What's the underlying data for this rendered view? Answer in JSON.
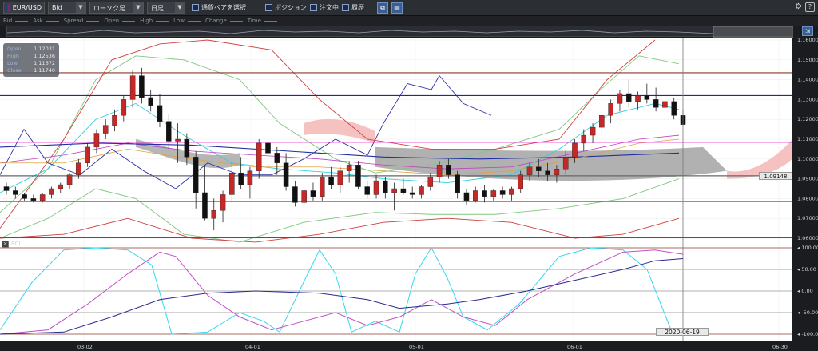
{
  "toolbar": {
    "symbol": "EUR/USD",
    "price_type": "Bid",
    "chart_type": "ローソク足",
    "timeframe": "日足",
    "select_pair_label": "通貨ペアを選択",
    "position_label": "ポジション",
    "orders_label": "注文中",
    "history_label": "履歴"
  },
  "legend": {
    "items": [
      "Bid",
      "Ask",
      "Spread",
      "Open",
      "High",
      "Low",
      "Change",
      "Time"
    ]
  },
  "ohlc": {
    "open_label": "Open",
    "open": "1.12031",
    "high_label": "High",
    "high": "1.12536",
    "low_label": "Low",
    "low": "1.11672",
    "close_label": "Close",
    "close": "1.11740"
  },
  "current_price": "1.09148",
  "cursor_date": "2020-06-19",
  "indicator_label": "RCI",
  "colors": {
    "background": "#ffffff",
    "bull": "#c62828",
    "bear": "#111111",
    "cloud_gray": "#9e9e9e",
    "cloud_pink": "#f3b6b6",
    "blue_line": "#1a2a9a",
    "magenta_line": "#e020d0",
    "brown_line": "#8b3a2a"
  },
  "chart_data": {
    "type": "candlestick",
    "y_ticks": [
      "1.16000",
      "1.15000",
      "1.14000",
      "1.13000",
      "1.12000",
      "1.11000",
      "1.10000",
      "1.09000",
      "1.08000",
      "1.07000",
      "1.06000"
    ],
    "ylim": [
      1.06,
      1.16
    ],
    "x_ticks": [
      "03-02",
      "04-01",
      "05-01",
      "06-01",
      "06-30"
    ],
    "rci_y_ticks": [
      "100.00",
      "50.00",
      "0.00",
      "-50.00",
      "-100.00"
    ],
    "rci_ylim": [
      -100,
      100
    ],
    "horizontal_lines": [
      {
        "y": 1.1435,
        "color": "#8b3a2a"
      },
      {
        "y": 1.132,
        "color": "#1a2a9a"
      },
      {
        "y": 1.1085,
        "color": "#e020d0"
      },
      {
        "y": 1.0785,
        "color": "#e020d0"
      },
      {
        "y": 1.0915,
        "color": "#666666"
      }
    ],
    "candles": [
      [
        1.086,
        1.088,
        1.082,
        1.084
      ],
      [
        1.084,
        1.086,
        1.08,
        1.082
      ],
      [
        1.082,
        1.083,
        1.079,
        1.08
      ],
      [
        1.08,
        1.082,
        1.078,
        1.079
      ],
      [
        1.079,
        1.083,
        1.078,
        1.082
      ],
      [
        1.082,
        1.086,
        1.08,
        1.085
      ],
      [
        1.085,
        1.088,
        1.083,
        1.087
      ],
      [
        1.087,
        1.093,
        1.085,
        1.092
      ],
      [
        1.092,
        1.1,
        1.09,
        1.098
      ],
      [
        1.098,
        1.108,
        1.096,
        1.106
      ],
      [
        1.106,
        1.115,
        1.103,
        1.113
      ],
      [
        1.113,
        1.12,
        1.11,
        1.117
      ],
      [
        1.117,
        1.125,
        1.114,
        1.122
      ],
      [
        1.122,
        1.132,
        1.119,
        1.13
      ],
      [
        1.13,
        1.145,
        1.126,
        1.142
      ],
      [
        1.142,
        1.146,
        1.128,
        1.131
      ],
      [
        1.131,
        1.135,
        1.124,
        1.127
      ],
      [
        1.127,
        1.133,
        1.116,
        1.119
      ],
      [
        1.119,
        1.123,
        1.105,
        1.109
      ],
      [
        1.109,
        1.118,
        1.098,
        1.11
      ],
      [
        1.11,
        1.113,
        1.097,
        1.101
      ],
      [
        1.101,
        1.104,
        1.075,
        1.083
      ],
      [
        1.083,
        1.097,
        1.069,
        1.07
      ],
      [
        1.07,
        1.08,
        1.064,
        1.074
      ],
      [
        1.074,
        1.084,
        1.068,
        1.082
      ],
      [
        1.082,
        1.098,
        1.078,
        1.093
      ],
      [
        1.093,
        1.101,
        1.085,
        1.087
      ],
      [
        1.087,
        1.096,
        1.08,
        1.094
      ],
      [
        1.094,
        1.11,
        1.09,
        1.108
      ],
      [
        1.108,
        1.112,
        1.1,
        1.103
      ],
      [
        1.103,
        1.106,
        1.092,
        1.098
      ],
      [
        1.098,
        1.103,
        1.084,
        1.086
      ],
      [
        1.086,
        1.089,
        1.076,
        1.078
      ],
      [
        1.078,
        1.085,
        1.077,
        1.084
      ],
      [
        1.084,
        1.088,
        1.079,
        1.081
      ],
      [
        1.081,
        1.093,
        1.079,
        1.091
      ],
      [
        1.091,
        1.096,
        1.085,
        1.087
      ],
      [
        1.087,
        1.096,
        1.083,
        1.094
      ],
      [
        1.094,
        1.099,
        1.088,
        1.097
      ],
      [
        1.097,
        1.099,
        1.085,
        1.086
      ],
      [
        1.086,
        1.089,
        1.08,
        1.082
      ],
      [
        1.082,
        1.092,
        1.08,
        1.089
      ],
      [
        1.089,
        1.091,
        1.08,
        1.083
      ],
      [
        1.083,
        1.088,
        1.074,
        1.085
      ],
      [
        1.085,
        1.09,
        1.082,
        1.083
      ],
      [
        1.083,
        1.086,
        1.08,
        1.082
      ],
      [
        1.082,
        1.087,
        1.08,
        1.086
      ],
      [
        1.086,
        1.093,
        1.084,
        1.091
      ],
      [
        1.091,
        1.099,
        1.088,
        1.097
      ],
      [
        1.097,
        1.1,
        1.09,
        1.092
      ],
      [
        1.092,
        1.094,
        1.08,
        1.083
      ],
      [
        1.083,
        1.085,
        1.077,
        1.079
      ],
      [
        1.079,
        1.086,
        1.078,
        1.084
      ],
      [
        1.084,
        1.087,
        1.078,
        1.081
      ],
      [
        1.081,
        1.085,
        1.079,
        1.084
      ],
      [
        1.084,
        1.086,
        1.08,
        1.082
      ],
      [
        1.082,
        1.086,
        1.079,
        1.085
      ],
      [
        1.085,
        1.094,
        1.083,
        1.092
      ],
      [
        1.092,
        1.098,
        1.089,
        1.096
      ],
      [
        1.096,
        1.1,
        1.091,
        1.094
      ],
      [
        1.094,
        1.098,
        1.089,
        1.092
      ],
      [
        1.092,
        1.097,
        1.088,
        1.095
      ],
      [
        1.095,
        1.104,
        1.092,
        1.101
      ],
      [
        1.101,
        1.11,
        1.098,
        1.108
      ],
      [
        1.108,
        1.115,
        1.104,
        1.112
      ],
      [
        1.112,
        1.118,
        1.108,
        1.116
      ],
      [
        1.116,
        1.124,
        1.112,
        1.122
      ],
      [
        1.122,
        1.13,
        1.118,
        1.128
      ],
      [
        1.128,
        1.135,
        1.124,
        1.133
      ],
      [
        1.133,
        1.14,
        1.126,
        1.129
      ],
      [
        1.129,
        1.134,
        1.125,
        1.132
      ],
      [
        1.132,
        1.138,
        1.128,
        1.13
      ],
      [
        1.13,
        1.136,
        1.124,
        1.126
      ],
      [
        1.126,
        1.132,
        1.122,
        1.129
      ],
      [
        1.129,
        1.131,
        1.12,
        1.122
      ],
      [
        1.122,
        1.125,
        1.117,
        1.1174
      ]
    ]
  }
}
